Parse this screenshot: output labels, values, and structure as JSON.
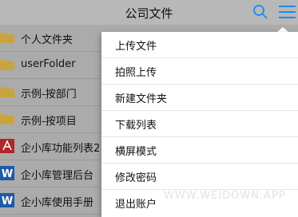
{
  "nav": {
    "title": "公司文件",
    "search_icon": "search-icon",
    "menu_icon": "hamburger-menu-icon",
    "accent_color": "#1a8cf0"
  },
  "files": [
    {
      "name": "个人文件夹",
      "icon": "folder-icon"
    },
    {
      "name": "userFolder",
      "icon": "folder-icon"
    },
    {
      "name": "示例-按部门",
      "icon": "folder-icon"
    },
    {
      "name": "示例-按项目",
      "icon": "folder-icon"
    },
    {
      "name": "企小库功能列表2",
      "icon": "pdf-icon"
    },
    {
      "name": "企小库管理后台",
      "icon": "word-icon"
    },
    {
      "name": "企小库使用手册",
      "icon": "word-icon"
    }
  ],
  "menu": {
    "items": [
      "上传文件",
      "拍照上传",
      "新建文件夹",
      "下载列表",
      "横屏模式",
      "修改密码",
      "退出账户"
    ]
  },
  "watermark": "WWW.WEIDOWN.APP"
}
